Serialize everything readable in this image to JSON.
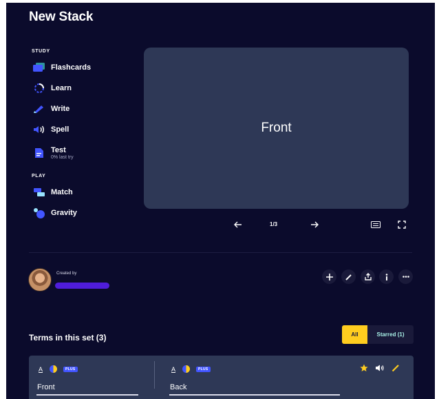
{
  "header": {
    "title": "New Stack"
  },
  "sidebar": {
    "study_label": "STUDY",
    "study_items": [
      {
        "label": "Flashcards",
        "icon": "flashcards-icon"
      },
      {
        "label": "Learn",
        "icon": "learn-icon"
      },
      {
        "label": "Write",
        "icon": "write-icon"
      },
      {
        "label": "Spell",
        "icon": "spell-icon"
      },
      {
        "label": "Test",
        "icon": "test-icon",
        "sublabel": "0% last try"
      }
    ],
    "play_label": "PLAY",
    "play_items": [
      {
        "label": "Match",
        "icon": "match-icon"
      },
      {
        "label": "Gravity",
        "icon": "gravity-icon"
      }
    ]
  },
  "flashcard": {
    "text": "Front",
    "counter": "1/3"
  },
  "creator": {
    "created_by_label": "Created by"
  },
  "terms": {
    "heading": "Terms in this set (3)",
    "filter_all": "All",
    "filter_starred": "Starred (1)",
    "plus_badge": "PLUS",
    "rows": [
      {
        "term": "Front",
        "definition": "Back",
        "starred": true
      }
    ]
  },
  "colors": {
    "background": "#0b0b2c",
    "card": "#2e3856",
    "accent_yellow": "#ffcd1f",
    "accent_blue": "#4255ff",
    "username_bar": "#4f1ddb"
  }
}
